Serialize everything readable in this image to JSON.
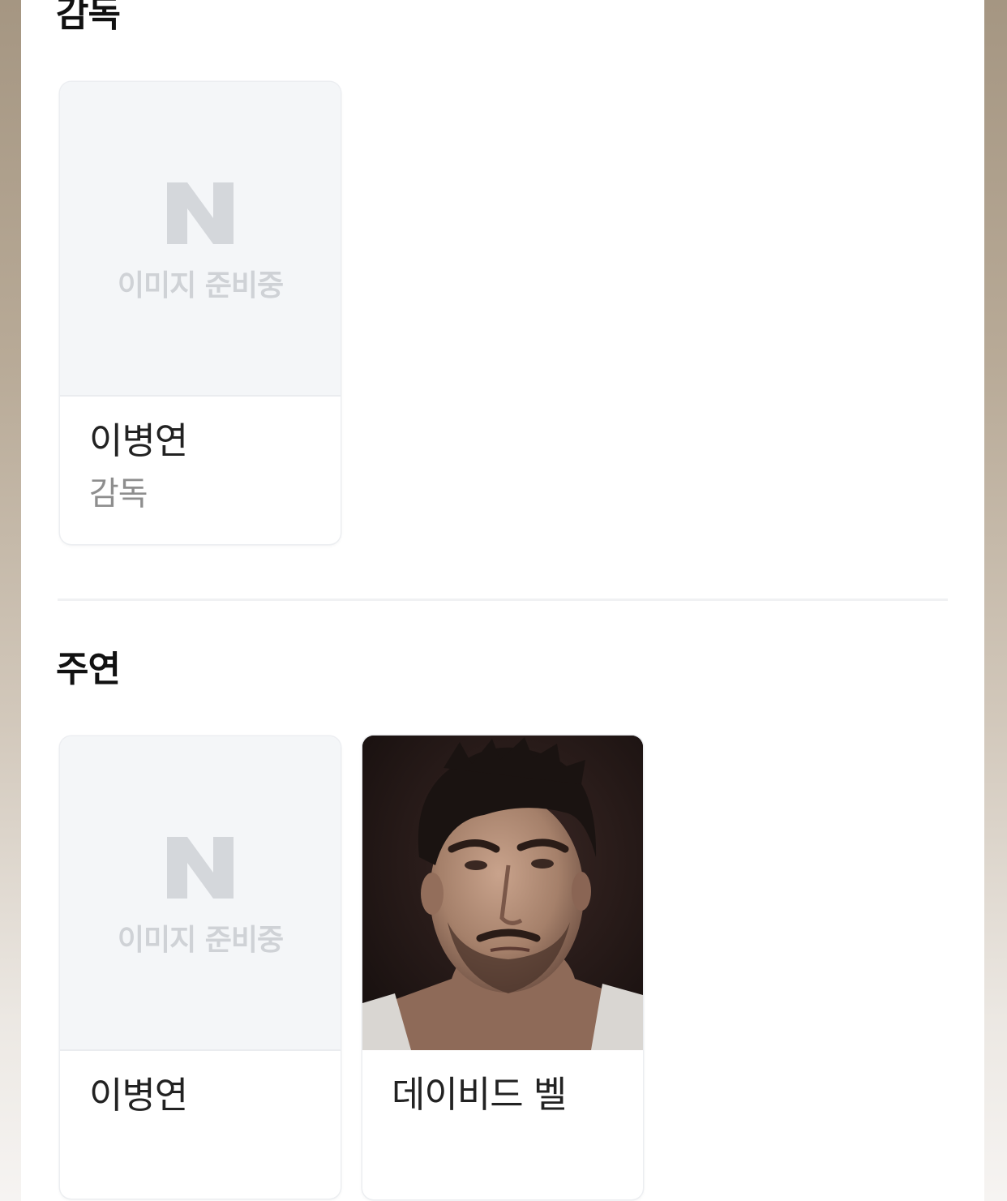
{
  "sections": {
    "director": {
      "title": "감독",
      "cards": [
        {
          "name": "이병연",
          "role": "감독",
          "image_placeholder": "이미지 준비중"
        }
      ]
    },
    "cast": {
      "title": "주연",
      "cards": [
        {
          "name": "이병연",
          "image_placeholder": "이미지 준비중"
        },
        {
          "name": "데이비드 벨"
        }
      ]
    }
  },
  "icons": {
    "placeholder": "naver-n-icon"
  },
  "colors": {
    "placeholder_bg": "#f4f6f8",
    "placeholder_fg": "#d4d7db",
    "title": "#111111",
    "name": "#222222",
    "role": "#8e8e8e"
  }
}
